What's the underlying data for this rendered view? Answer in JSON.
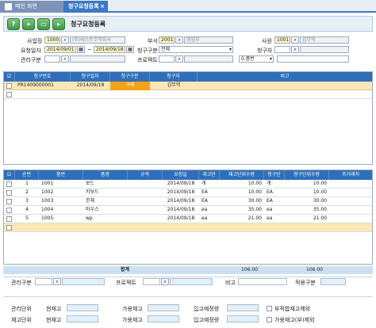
{
  "tabs": {
    "home": "메인 화면",
    "current": "청구요청등록",
    "close": "×"
  },
  "toolbar": {
    "title": "청구요청등록",
    "btn1": "?",
    "btn2": "+",
    "btn3": "▭",
    "btn4": "▸"
  },
  "search": {
    "workplace_label": "사업장",
    "workplace_code": "1000",
    "workplace_name": "(주)테스트무역회사",
    "dept_label": "부서",
    "dept_code": "2001",
    "dept_name": "영업부",
    "emp_label": "사원",
    "emp_code": "1001",
    "emp_name": "김무역",
    "period_label": "요청일자",
    "date_from": "2014/09/01",
    "date_tilde": "~",
    "date_to": "2014/09/18",
    "claim_type_label": "청구구분",
    "claim_type_value": "전체",
    "claimer_label": "청구자",
    "mgmt_label": "관리구분",
    "project_label": "프로젝트",
    "pumbeon_label": "0.품번"
  },
  "grid1": {
    "headers": [
      "청구번호",
      "청구일자",
      "청구구분",
      "청구자",
      "비고"
    ],
    "rows": [
      {
        "no": "PR1409000001",
        "date": "2014/09/18",
        "type": "구매",
        "claimer": "김무역",
        "memo": ""
      }
    ]
  },
  "grid2": {
    "headers": [
      "순번",
      "품번",
      "품명",
      "규격",
      "요청일",
      "재고단",
      "재고단위수량",
      "청구단",
      "청구단위수량",
      "주거래처"
    ],
    "rows": [
      {
        "seq": "1",
        "code": "1001",
        "name": "보드",
        "spec": "",
        "date": "2014/09/18",
        "unit": "개",
        "qty": "10.00",
        "cunit": "개",
        "cqty": "10.00",
        "vendor": ""
      },
      {
        "seq": "2",
        "code": "1002",
        "name": "키보드",
        "spec": "",
        "date": "2014/09/18",
        "unit": "EA",
        "qty": "10.00",
        "cunit": "EA",
        "cqty": "10.00",
        "vendor": ""
      },
      {
        "seq": "3",
        "code": "1003",
        "name": "본체",
        "spec": "",
        "date": "2014/09/18",
        "unit": "EA",
        "qty": "30.00",
        "cunit": "EA",
        "cqty": "30.00",
        "vendor": ""
      },
      {
        "seq": "4",
        "code": "1004",
        "name": "마우스",
        "spec": "",
        "date": "2014/09/18",
        "unit": "ea",
        "qty": "35.00",
        "cunit": "ea",
        "cqty": "35.00",
        "vendor": ""
      },
      {
        "seq": "5",
        "code": "1005",
        "name": "wp",
        "spec": "",
        "date": "2014/09/18",
        "unit": "ea",
        "qty": "21.00",
        "cunit": "ea",
        "cqty": "21.00",
        "vendor": ""
      }
    ],
    "sum_label": "합계",
    "sum_qty": "106.00",
    "sum_cqty": "106.00"
  },
  "bottom": {
    "mgmt_label": "관리구분",
    "project_label": "프로젝트",
    "memo_label": "비고",
    "apply_label": "적용구분",
    "r1_unit": "관리단위",
    "r1_cur": "현재고",
    "r1_avail": "가용재고",
    "r1_in": "입고예정량",
    "r1_check": "부적합재고제외",
    "r2_unit": "재고단위",
    "r2_cur": "현재고",
    "r2_avail": "가용재고",
    "r2_in": "입고예정량",
    "r2_check": "가용재고(부)제외"
  },
  "colors": {
    "accent": "#3a78c8",
    "header": "#2f6fba",
    "selected_row": "#fde7b6",
    "highlight": "#f7a11a"
  }
}
